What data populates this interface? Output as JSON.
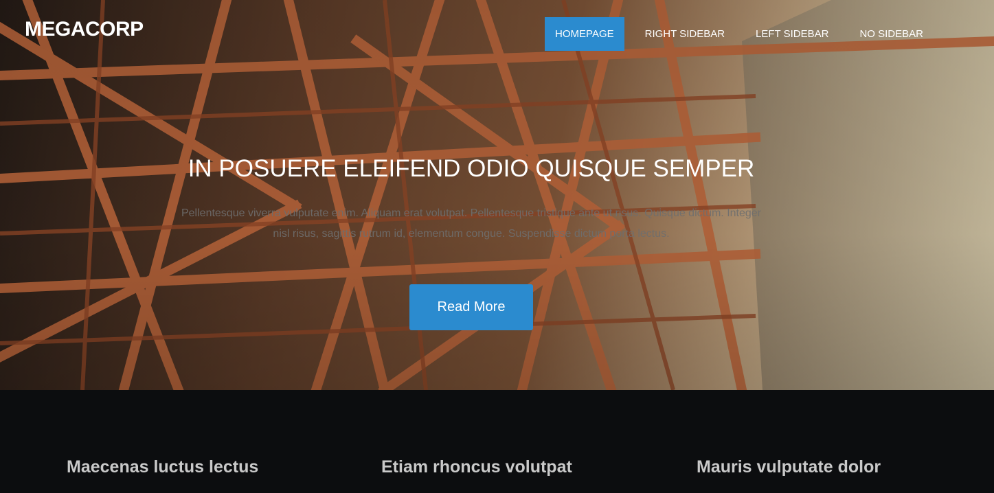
{
  "brand": {
    "logo": "MEGACORP"
  },
  "nav": {
    "items": [
      {
        "label": "HOMEPAGE",
        "active": true
      },
      {
        "label": "RIGHT SIDEBAR",
        "active": false
      },
      {
        "label": "LEFT SIDEBAR",
        "active": false
      },
      {
        "label": "NO SIDEBAR",
        "active": false
      }
    ]
  },
  "hero": {
    "title": "IN POSUERE ELEIFEND ODIO QUISQUE SEMPER",
    "text": "Pellentesque viverra vulputate enim. Aliquam erat volutpat. Pellentesque tristique ante ut risus. Quisque dictum. Integer nisl risus, sagittis rutrum id, elementum congue. Suspendisse dictum porta lectus.",
    "button_label": "Read More"
  },
  "features": [
    {
      "title": "Maecenas luctus lectus"
    },
    {
      "title": "Etiam rhoncus volutpat"
    },
    {
      "title": "Mauris vulputate dolor"
    }
  ],
  "colors": {
    "accent": "#2b8bcf",
    "dark_bg": "#0c0d0f"
  }
}
